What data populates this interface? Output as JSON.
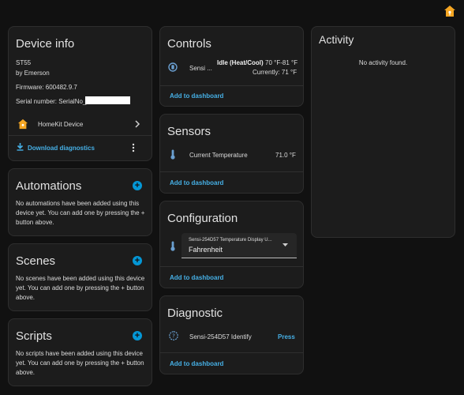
{
  "top_home_icon": "home-icon",
  "device_info": {
    "title": "Device info",
    "model": "ST55",
    "manufacturer": "by Emerson",
    "firmware": "Firmware: 600482.9.7",
    "serial": "Serial number: SerialNo_",
    "homekit_label": "HomeKit Device",
    "download_label": "Download diagnostics"
  },
  "automations": {
    "title": "Automations",
    "text": "No automations have been added using this device yet. You can add one by pressing the + button above."
  },
  "scenes": {
    "title": "Scenes",
    "text": "No scenes have been added using this device yet. You can add one by pressing the + button above."
  },
  "scripts": {
    "title": "Scripts",
    "text": "No scripts have been added using this device yet. You can add one by pressing the + button above."
  },
  "controls": {
    "title": "Controls",
    "entity_name": "Sensi ...",
    "state": "Idle (Heat/Cool)",
    "range": "70 °F-81 °F",
    "current": "Currently: 71 °F",
    "add_label": "Add to dashboard"
  },
  "sensors": {
    "title": "Sensors",
    "entity_name": "Current Temperature",
    "value": "71.0 °F",
    "add_label": "Add to dashboard"
  },
  "configuration": {
    "title": "Configuration",
    "select_label": "Sensi-254D57 Temperature Display U...",
    "select_value": "Fahrenheit",
    "add_label": "Add to dashboard"
  },
  "diagnostic": {
    "title": "Diagnostic",
    "entity_name": "Sensi-254D57 Identify",
    "button_label": "Press",
    "add_label": "Add to dashboard"
  },
  "activity": {
    "title": "Activity",
    "empty": "No activity found."
  },
  "colors": {
    "accent": "#46b0e6",
    "plus": "#0497d6",
    "card": "#1c1c1c",
    "background": "#111111",
    "home_orange": "#f5a623"
  }
}
